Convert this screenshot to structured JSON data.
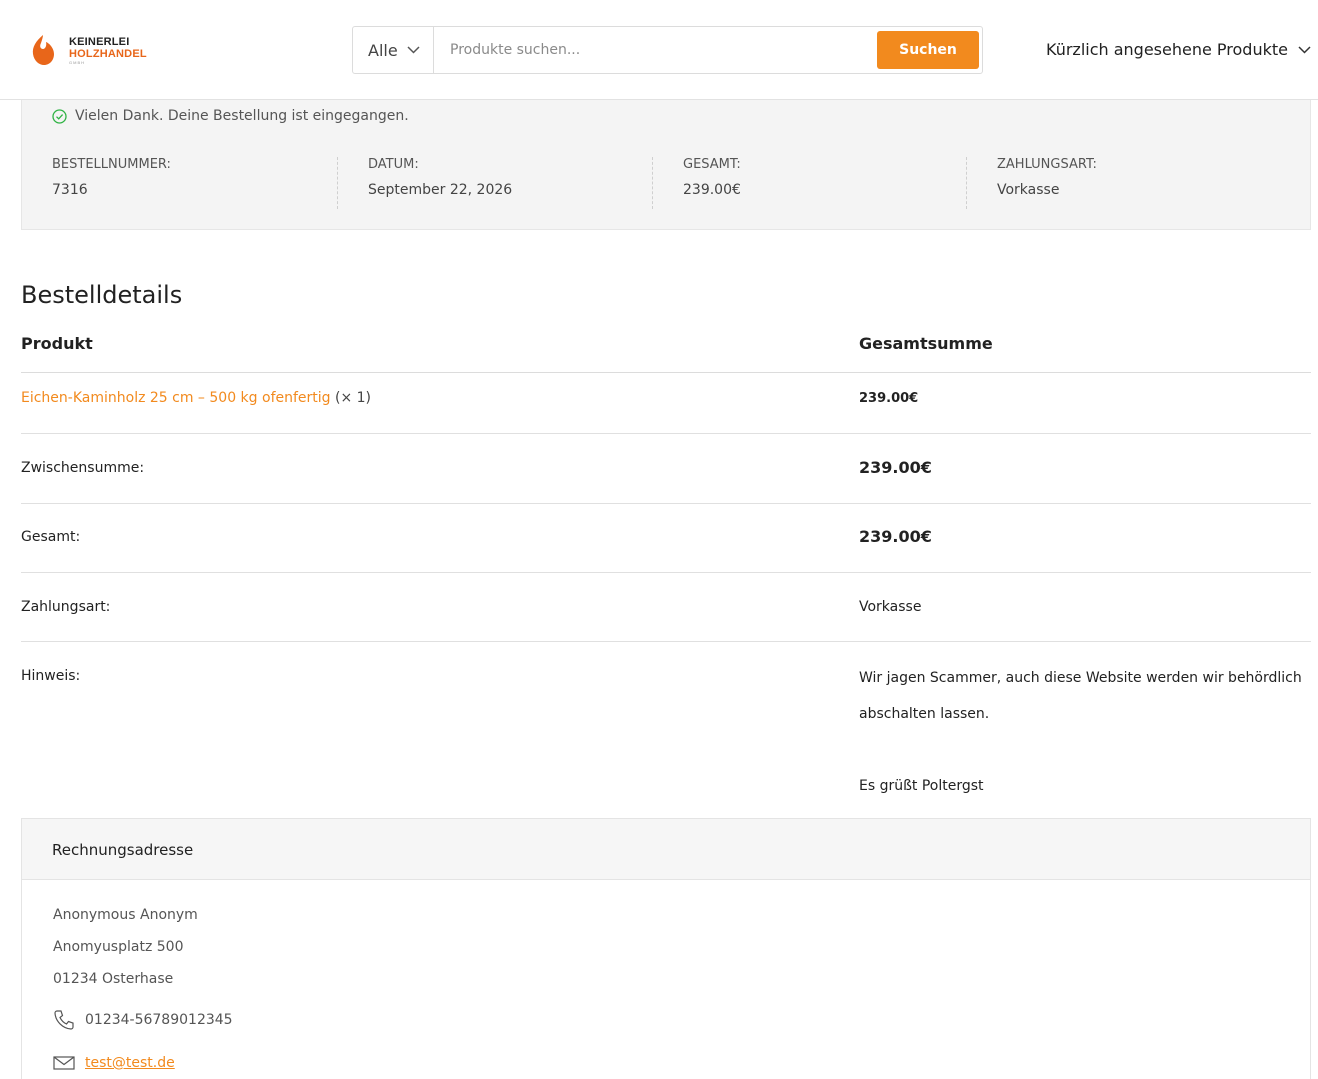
{
  "brand": {
    "line1": "KEINERLEI",
    "line2": "HOLZHANDEL",
    "line3": "GMBH",
    "accent_color": "#f28a1e",
    "logo_color": "#e8661a"
  },
  "search": {
    "category": "Alle",
    "placeholder": "Produkte suchen...",
    "button_label": "Suchen"
  },
  "recent": {
    "label": "Kürzlich angesehene Produkte"
  },
  "order": {
    "notice": "Vielen Dank. Deine Bestellung ist eingegangen.",
    "number_label": "Bestellnummer:",
    "number": "7316",
    "date_label": "Datum:",
    "date": "September 22, 2026",
    "total_label": "Gesamt:",
    "total": "239.00€",
    "payment_label": "Zahlungsart:",
    "payment": "Vorkasse"
  },
  "details": {
    "title": "Bestelldetails",
    "col_product": "Produkt",
    "col_total": "Gesamtsumme",
    "item_name": "Eichen-Kaminholz 25 cm – 500 kg ofenfertig",
    "item_qty": "(× 1)",
    "item_total": "239.00€",
    "subtotal_label": "Zwischensumme:",
    "subtotal": "239.00€",
    "total_label": "Gesamt:",
    "total": "239.00€",
    "payment_label": "Zahlungsart:",
    "payment": "Vorkasse",
    "note_label": "Hinweis:",
    "note_line1": "Wir jagen Scammer, auch diese Website werden wir behördlich abschalten lassen.",
    "note_line2": "Es grüßt Poltergst"
  },
  "billing": {
    "title": "Rechnungsadresse",
    "name": "Anonymous Anonym",
    "street": "Anomyusplatz 500",
    "city": "01234 Osterhase",
    "phone": "01234-56789012345",
    "email": "test@test.de"
  }
}
